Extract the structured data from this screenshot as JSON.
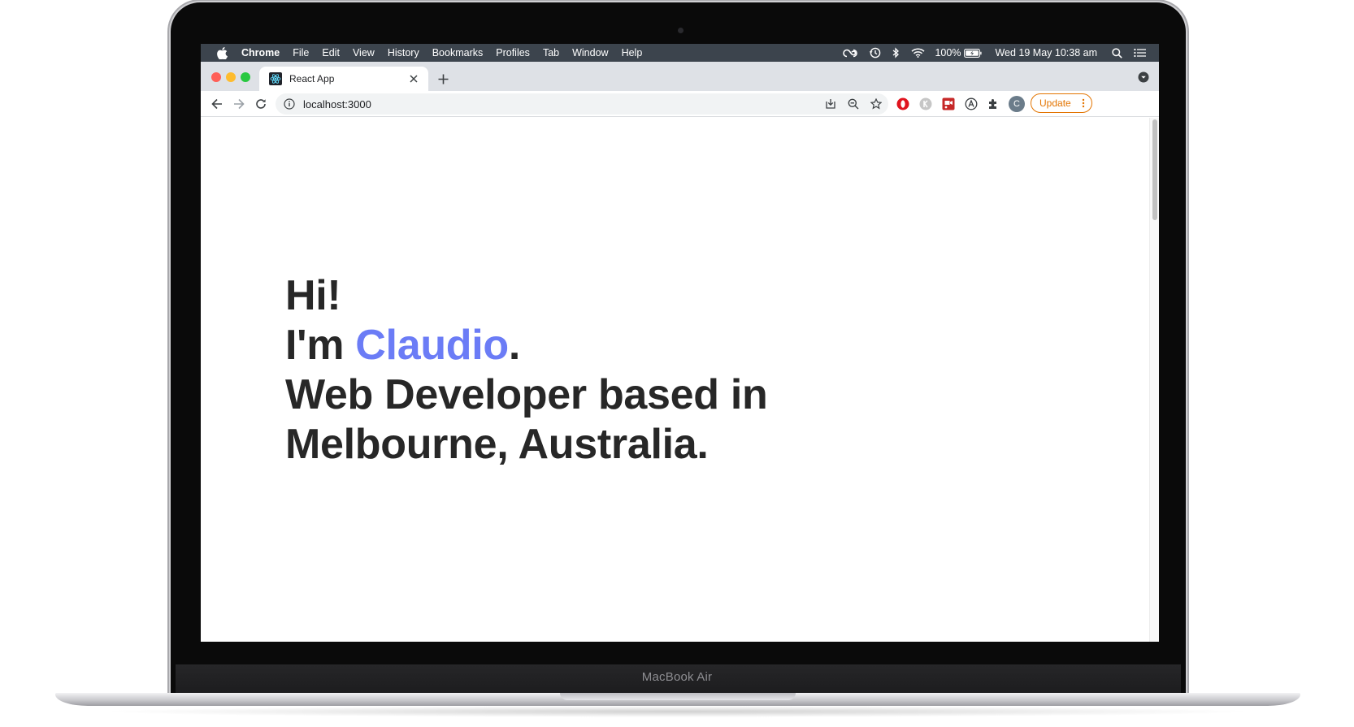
{
  "device": {
    "label": "MacBook Air"
  },
  "menubar": {
    "app_name": "Chrome",
    "items": [
      "File",
      "Edit",
      "View",
      "History",
      "Bookmarks",
      "Profiles",
      "Tab",
      "Window",
      "Help"
    ],
    "battery": "100%",
    "datetime": "Wed 19 May  10:38 am",
    "icons": [
      "creative-cloud-icon",
      "time-machine-icon",
      "bluetooth-icon",
      "wifi-icon",
      "battery-icon",
      "spotlight-icon",
      "control-center-icon"
    ]
  },
  "browser": {
    "tab": {
      "title": "React App",
      "favicon": "react-icon"
    },
    "url": "localhost:3000",
    "update_label": "Update",
    "profile_initial": "C",
    "extensions": [
      "opera-icon",
      "k-extension-icon",
      "screen-recorder-icon",
      "a-extension-icon",
      "puzzle-icon"
    ]
  },
  "hero": {
    "line1": "Hi!",
    "line2_prefix": "I'm ",
    "name": "Claudio",
    "line2_suffix": ".",
    "line3": "Web Developer based in",
    "line4": "Melbourne, Australia.",
    "accent_color": "#6b7cf6"
  }
}
